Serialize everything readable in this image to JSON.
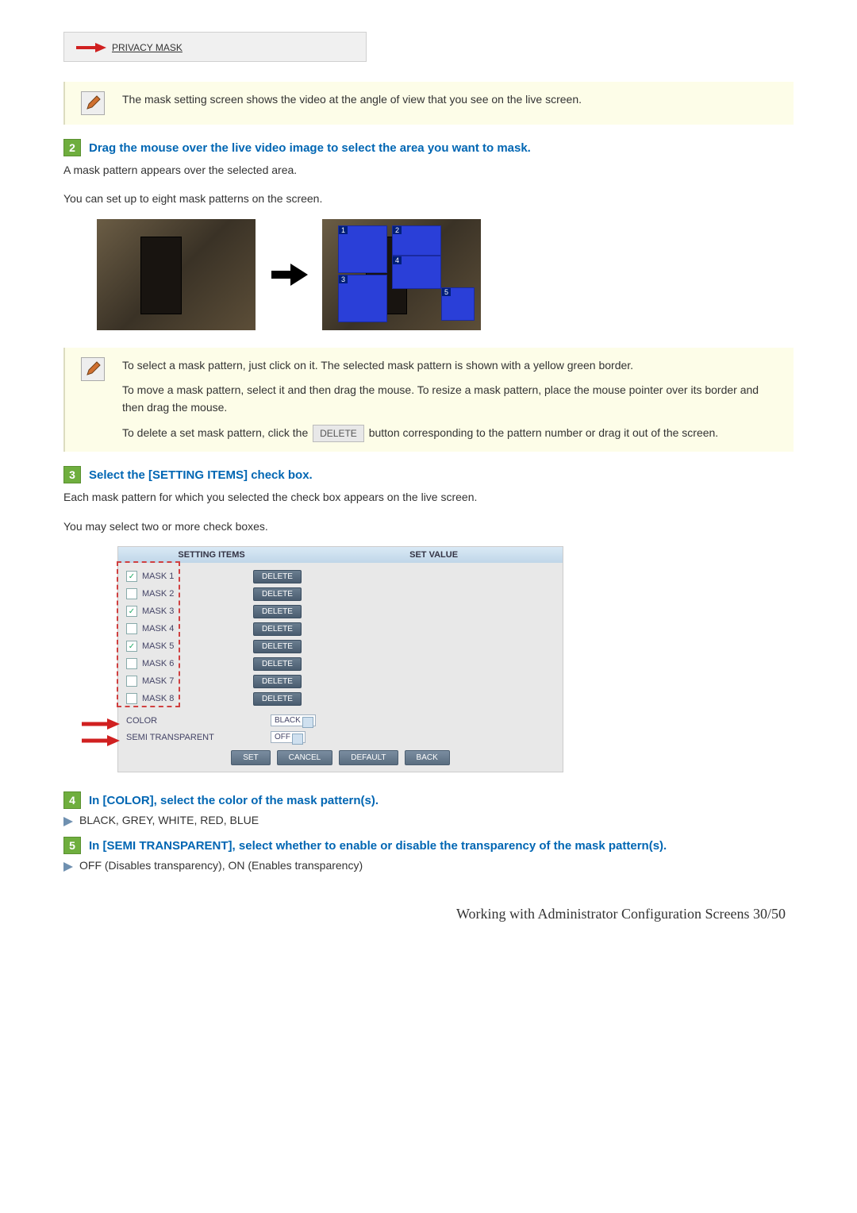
{
  "menu": {
    "privacy_mask": "PRIVACY MASK"
  },
  "note1": {
    "text": "The mask setting screen shows the video at the angle of view that you see on the live screen."
  },
  "step2": {
    "badge": "2",
    "title": "Drag the mouse over the live video image to select the area you want to mask.",
    "line1": "A mask pattern appears over the selected area.",
    "line2": "You can set up to eight mask patterns on the screen.",
    "mask_labels": [
      "1",
      "2",
      "3",
      "4",
      "5"
    ]
  },
  "note2": {
    "p1": "To select a mask pattern, just click on it. The selected mask pattern is shown with a yellow green border.",
    "p2": "To move a mask pattern, select it and then drag the mouse. To resize a mask pattern, place the mouse pointer over its border and then drag the mouse.",
    "p3_a": "To delete a set mask pattern, click the ",
    "p3_btn": "DELETE",
    "p3_b": " button corresponding to the pattern number or drag it out of the screen."
  },
  "step3": {
    "badge": "3",
    "title": "Select the [SETTING ITEMS] check box.",
    "line1": "Each mask pattern for which you selected the check box appears on the live screen.",
    "line2": "You may select two or more check boxes."
  },
  "table": {
    "col_left": "SETTING ITEMS",
    "col_right": "SET VALUE",
    "masks": [
      {
        "label": "MASK 1",
        "checked": true
      },
      {
        "label": "MASK 2",
        "checked": false
      },
      {
        "label": "MASK 3",
        "checked": true
      },
      {
        "label": "MASK 4",
        "checked": false
      },
      {
        "label": "MASK 5",
        "checked": true
      },
      {
        "label": "MASK 6",
        "checked": false
      },
      {
        "label": "MASK 7",
        "checked": false
      },
      {
        "label": "MASK 8",
        "checked": false
      }
    ],
    "delete_label": "DELETE",
    "color_label": "COLOR",
    "color_value": "BLACK",
    "semi_label": "SEMI TRANSPARENT",
    "semi_value": "OFF",
    "buttons": {
      "set": "SET",
      "cancel": "CANCEL",
      "default": "DEFAULT",
      "back": "BACK"
    }
  },
  "step4": {
    "badge": "4",
    "title": "In [COLOR], select the color of the mask pattern(s).",
    "bullet": "BLACK, GREY, WHITE, RED, BLUE"
  },
  "step5": {
    "badge": "5",
    "title": "In [SEMI TRANSPARENT], select whether to enable or disable the transparency of the mask pattern(s).",
    "bullet": "OFF (Disables transparency), ON (Enables transparency)"
  },
  "footer": {
    "text_a": "Working with Administrator Configuration Screens ",
    "text_b": "30/50"
  }
}
